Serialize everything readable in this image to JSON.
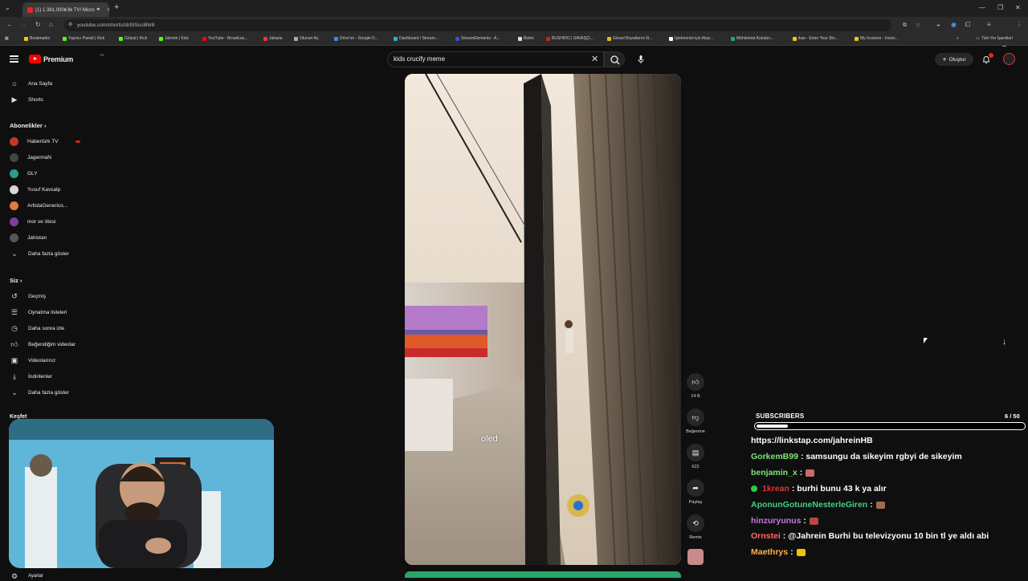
{
  "browser": {
    "tab_title": "(1) 1.381.000₺'lik TV! Micro",
    "url": "youtube.com/shorts/sbSIScc8Nr8",
    "all_bookmarks": "Tüm Yer İşaretleri",
    "bookmarks": [
      "Bookmarks",
      "Yayıncı Paneli | Kick",
      "Götzat | Kick",
      "Jahrein | Kick",
      "YouTube - Broadcas...",
      "Jaharia",
      "Oturum Aç",
      "Drive'ım - Google D...",
      "Dashboard / Stream...",
      "StreamElements - A...",
      "Botrix",
      "BUSHIDO | SAVAŞÇI...",
      "Görsel Boyutlarını N...",
      "İşletmenizi için Alışv...",
      "Mühimmat Kutuları...",
      "ikas - Enter Your Sto...",
      "My Invoices - Invoic..."
    ]
  },
  "header": {
    "logo_text": "Premium",
    "logo_sup": "TR",
    "search_value": "kids crucify meme",
    "create_label": "Oluştur"
  },
  "sidebar": {
    "home": "Ana Sayfa",
    "shorts": "Shorts",
    "subscriptions_heading": "Abonelikler",
    "channels": [
      {
        "name": "Habertürk TV",
        "color": "#c0392b"
      },
      {
        "name": "JagermaN",
        "color": "#444444"
      },
      {
        "name": "GLY",
        "color": "#2a9d8f"
      },
      {
        "name": "Yusuf Kavsalp",
        "color": "#d8d8d8"
      },
      {
        "name": "ArtistaGenerico...",
        "color": "#e07b39"
      },
      {
        "name": "mor ve ötesi",
        "color": "#7b3fa0"
      },
      {
        "name": "Jahistan",
        "color": "#555555"
      }
    ],
    "show_more": "Daha fazla göster",
    "you_heading": "Siz",
    "you_items": [
      "Geçmiş",
      "Oynatma listeleri",
      "Daha sonra izle",
      "Beğendiğim videolar",
      "Videolarınız",
      "İndirilenler",
      "Daha fazla göster"
    ],
    "explore_heading": "Keşfet",
    "settings": "Ayarlar"
  },
  "video": {
    "caption": "oled",
    "likes": "14 B",
    "dislike_label": "Beğenme",
    "comments": "622",
    "share_label": "Paylaş",
    "remix_label": "Remix"
  },
  "overlay": {
    "subscribers_label": "SUBSCRIBERS",
    "subscribers_count": "6 / 50",
    "subscribers_progress": 0.12,
    "chat": [
      {
        "user": "",
        "text": "https://linkstap.com/jahreinHB",
        "color": "#ffffff"
      },
      {
        "user": "GorkemB99",
        "text": ": samsungu da sikeyim rgbyi de sikeyim",
        "color": "#7fe37a"
      },
      {
        "user": "benjamin_x",
        "text": ":",
        "color": "#7fe37a",
        "emote": "#c96b6b"
      },
      {
        "user": "1krean",
        "text": ": burhi bunu 43 k ya alır",
        "color": "#e0343a",
        "verified": true
      },
      {
        "user": "AponunGotuneNesterleGiren",
        "text": ":",
        "color": "#3fd18a",
        "emote": "#a36b4a"
      },
      {
        "user": "hinzuryunus",
        "text": ":",
        "color": "#c27ae6",
        "emote": "#b44a3f"
      },
      {
        "user": "Ornstei",
        "text": ": @Jahrein Burhi bu televizyonu 10 bin tl ye aldı abi",
        "color": "#ff6b6b"
      },
      {
        "user": "Maethrys",
        "text": ":",
        "color": "#ffb347",
        "emote": "#f2c200"
      }
    ]
  }
}
